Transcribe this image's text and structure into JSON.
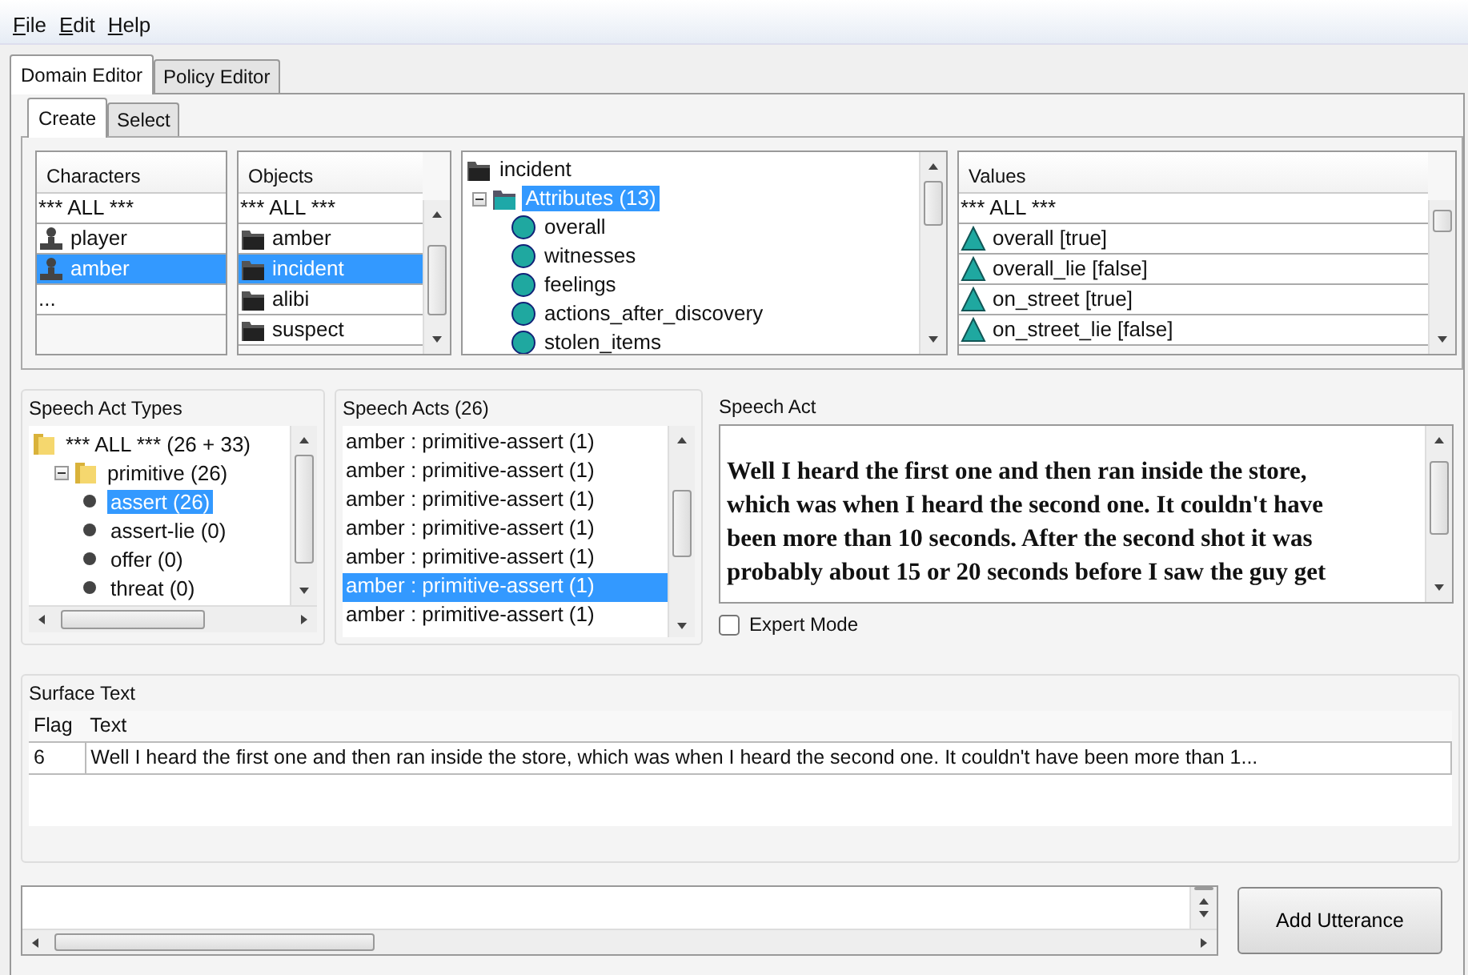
{
  "menu": [
    {
      "label": "File"
    },
    {
      "label": "Edit"
    },
    {
      "label": "Help"
    }
  ],
  "tabs": [
    {
      "label": "Domain Editor",
      "selected": true
    },
    {
      "label": "Policy Editor",
      "selected": false
    }
  ],
  "subtabs": [
    {
      "label": "Create",
      "selected": true
    },
    {
      "label": "Select",
      "selected": false
    }
  ],
  "characters": {
    "header": "Characters",
    "items": [
      {
        "label": "*** ALL ***",
        "kind": "plain",
        "selected": false
      },
      {
        "label": "player",
        "kind": "person",
        "selected": false
      },
      {
        "label": "amber",
        "kind": "person",
        "selected": true
      },
      {
        "label": "...",
        "kind": "plain",
        "selected": false
      }
    ]
  },
  "objects": {
    "header": "Objects",
    "items": [
      {
        "label": "*** ALL ***",
        "kind": "plain",
        "selected": false
      },
      {
        "label": "amber",
        "kind": "folder",
        "selected": false
      },
      {
        "label": "incident",
        "kind": "folder",
        "selected": true
      },
      {
        "label": "alibi",
        "kind": "folder",
        "selected": false
      },
      {
        "label": "suspect",
        "kind": "folder",
        "selected": false
      }
    ]
  },
  "attribute_tree": {
    "label": "incident",
    "kind": "folder",
    "selected": false,
    "children": [
      {
        "label": "Attributes (13)",
        "kind": "teal-folder",
        "selected": true,
        "expanded": true,
        "children": [
          {
            "label": "overall",
            "kind": "attribute",
            "selected": false
          },
          {
            "label": "witnesses",
            "kind": "attribute",
            "selected": false
          },
          {
            "label": "feelings",
            "kind": "attribute",
            "selected": false
          },
          {
            "label": "actions_after_discovery",
            "kind": "attribute",
            "selected": false
          },
          {
            "label": "stolen_items",
            "kind": "attribute",
            "selected": false
          }
        ]
      }
    ]
  },
  "values": {
    "header": "Values",
    "items": [
      {
        "label": "*** ALL ***",
        "kind": "plain",
        "selected": false
      },
      {
        "label": "overall [true]",
        "kind": "value",
        "selected": false
      },
      {
        "label": "overall_lie [false]",
        "kind": "value",
        "selected": false
      },
      {
        "label": "on_street [true]",
        "kind": "value",
        "selected": false
      },
      {
        "label": "on_street_lie [false]",
        "kind": "value",
        "selected": false
      }
    ]
  },
  "speech_act_types": {
    "title": "Speech Act Types",
    "tree": {
      "label": "*** ALL *** (26 + 33)",
      "kind": "folder",
      "selected": false,
      "children": [
        {
          "label": "primitive (26)",
          "kind": "folder",
          "selected": false,
          "expanded": true,
          "children": [
            {
              "label": "assert (26)",
              "kind": "bullet",
              "selected": true
            },
            {
              "label": "assert-lie (0)",
              "kind": "bullet",
              "selected": false
            },
            {
              "label": "offer (0)",
              "kind": "bullet",
              "selected": false
            },
            {
              "label": "threat (0)",
              "kind": "bullet",
              "selected": false
            }
          ]
        }
      ]
    }
  },
  "speech_acts": {
    "title": "Speech Acts (26)",
    "items": [
      {
        "label": "amber : primitive-assert (1)",
        "selected": false
      },
      {
        "label": "amber : primitive-assert (1)",
        "selected": false
      },
      {
        "label": "amber : primitive-assert (1)",
        "selected": false
      },
      {
        "label": "amber : primitive-assert (1)",
        "selected": false
      },
      {
        "label": "amber : primitive-assert (1)",
        "selected": false
      },
      {
        "label": "amber : primitive-assert (1)",
        "selected": true
      },
      {
        "label": "amber : primitive-assert (1)",
        "selected": false
      }
    ]
  },
  "speech_act": {
    "title": "Speech Act",
    "lines": [
      "Well I heard the first one and then ran inside the store,",
      "which was when I heard the second one. It couldn't have",
      "been more than 10 seconds. After the second shot it was",
      "probably about 15 or 20 seconds before I saw the guy get"
    ],
    "expert_mode": {
      "label": "Expert Mode",
      "checked": false
    }
  },
  "surface_text": {
    "title": "Surface Text",
    "columns": [
      "Flag",
      "Text"
    ],
    "rows": [
      [
        "6",
        "Well I heard the first one and then ran inside the store, which was when I heard the second one.  It couldn't have been more than 1..."
      ]
    ]
  },
  "add_button": "Add Utterance"
}
